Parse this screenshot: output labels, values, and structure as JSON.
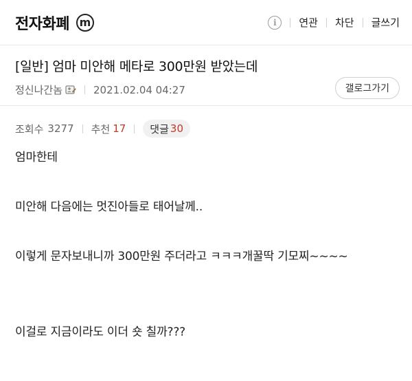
{
  "header": {
    "gallery_name": "전자화폐",
    "m_badge": "m",
    "info_icon": "i",
    "links": [
      "연관",
      "차단",
      "글쓰기"
    ]
  },
  "post": {
    "title": "[일반] 엄마 미안해 메타로 300만원 받았는데",
    "author": "정신나간놈",
    "datetime": "2021.02.04 04:27",
    "gallery_button": "갤로그가기",
    "views_label": "조회수",
    "views": "3277",
    "recommend_label": "추천",
    "recommend": "17",
    "comments_label": "댓글",
    "comments": "30"
  },
  "body": {
    "lines": [
      "엄마한테",
      "미안해 다음에는 멋진아들로 태어날께..",
      "이렇게 문자보내니까 300만원 주더라고 ㅋㅋㅋ개꿀딱 기모찌~~~~",
      "이걸로 지금이라도 이더 숏 칠까???"
    ]
  },
  "colors": {
    "accent_red": "#c0392b",
    "text": "#222222",
    "meta": "#666666"
  }
}
